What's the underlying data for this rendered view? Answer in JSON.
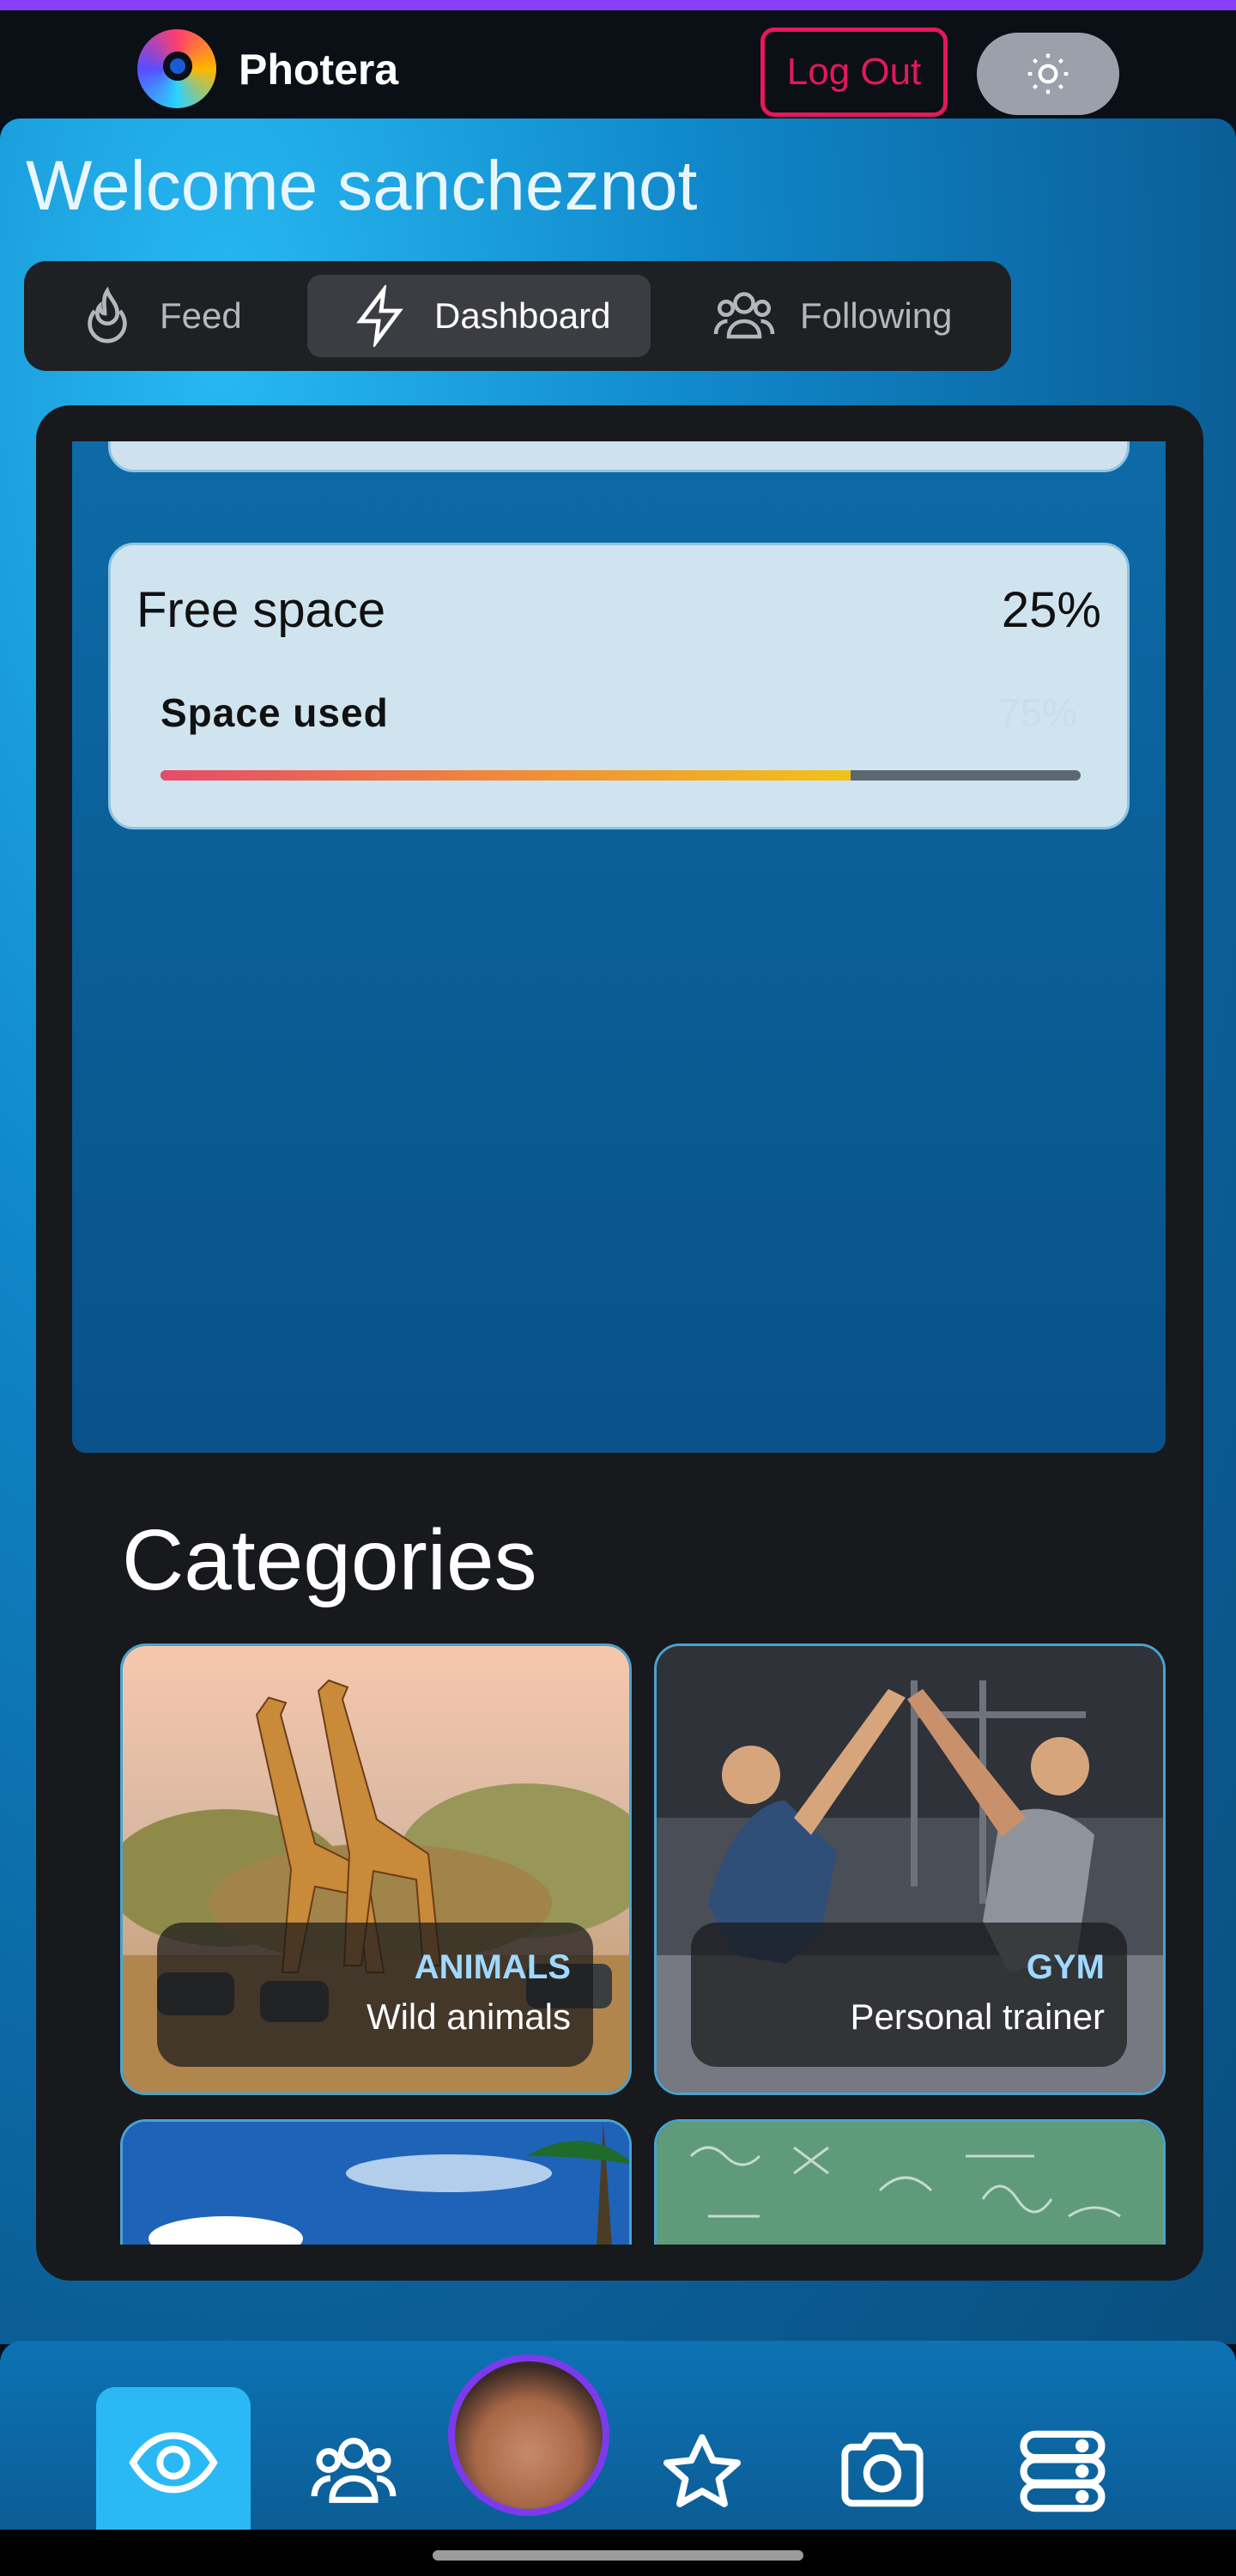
{
  "app": {
    "title": "Photera"
  },
  "header": {
    "logout_label": "Log Out",
    "theme_toggle_icon": "sun-icon"
  },
  "welcome": {
    "text": "Welcome sancheznot"
  },
  "tabs": [
    {
      "label": "Feed",
      "icon": "flame-icon",
      "active": false
    },
    {
      "label": "Dashboard",
      "icon": "lightning-icon",
      "active": true
    },
    {
      "label": "Following",
      "icon": "users-icon",
      "active": false
    }
  ],
  "storage": {
    "title": "Free space",
    "free_percent": "25%",
    "used_label": "Space used",
    "used_percent_text": "75%",
    "used_fraction": 0.75,
    "bar_colors": [
      "#e54b6a",
      "#f08a3a",
      "#f2c219"
    ]
  },
  "categories": {
    "title": "Categories",
    "items": [
      {
        "name": "ANIMALS",
        "subtitle": "Wild animals"
      },
      {
        "name": "GYM",
        "subtitle": "Personal trainer"
      }
    ]
  },
  "bottom_nav": {
    "items": [
      {
        "icon": "eye-icon",
        "active": true
      },
      {
        "icon": "users-icon",
        "active": false
      },
      {
        "icon": "avatar",
        "active": false
      },
      {
        "icon": "star-icon",
        "active": false
      },
      {
        "icon": "camera-icon",
        "active": false
      },
      {
        "icon": "server-icon",
        "active": false
      }
    ]
  },
  "colors": {
    "accent": "#8a3ffc",
    "logout": "#e2195a",
    "active_nav": "#2ab9f5"
  }
}
